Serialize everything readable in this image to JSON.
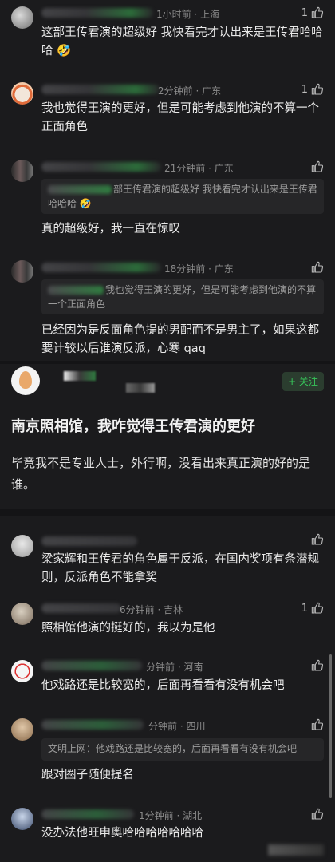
{
  "comments": [
    {
      "time": "1小时前 · 上海",
      "text": "这部王传君演的超级好 我快看完才认出来是王传君哈哈哈 🤣",
      "likes": "1"
    },
    {
      "time": "2分钟前 · 广东",
      "text": "我也觉得王演的更好，但是可能考虑到他演的不算一个正面角色",
      "likes": "1"
    },
    {
      "time": "21分钟前 · 广东",
      "quote": "部王传君演的超级好 我快看完才认出来是王传君哈哈哈 🤣",
      "text": "真的超级好，我一直在惊叹"
    },
    {
      "time": "18分钟前 · 广东",
      "quote": "我也觉得王演的更好，但是可能考虑到他演的不算一个正面角色",
      "text": "已经因为是反面角色提的男配而不是男主了，如果这都要计较以后谁演反派，心寒 qaq"
    }
  ],
  "post": {
    "follow_label": "+ 关注",
    "title": "南京照相馆，我咋觉得王传君演的更好",
    "body": "毕竟我不是专业人士，外行啊，没看出来真正演的好的是谁。"
  },
  "replies": [
    {
      "time": "",
      "text": "梁家辉和王传君的角色属于反派，在国内奖项有条潜规则，反派角色不能拿奖"
    },
    {
      "time": "6分钟前 · 吉林",
      "text": "照相馆他演的挺好的，我以为是他",
      "likes": "1"
    },
    {
      "time": "分钟前 · 河南",
      "text": "他戏路还是比较宽的，后面再看看有没有机会吧"
    },
    {
      "time": "分钟前 · 四川",
      "quote": "文明上网：他戏路还是比较宽的，后面再看看有没有机会吧",
      "text": "跟对圈子随便提名"
    },
    {
      "time": "1分钟前 · 湖北",
      "text": "没办法他旺申奥哈哈哈哈哈哈哈"
    }
  ]
}
